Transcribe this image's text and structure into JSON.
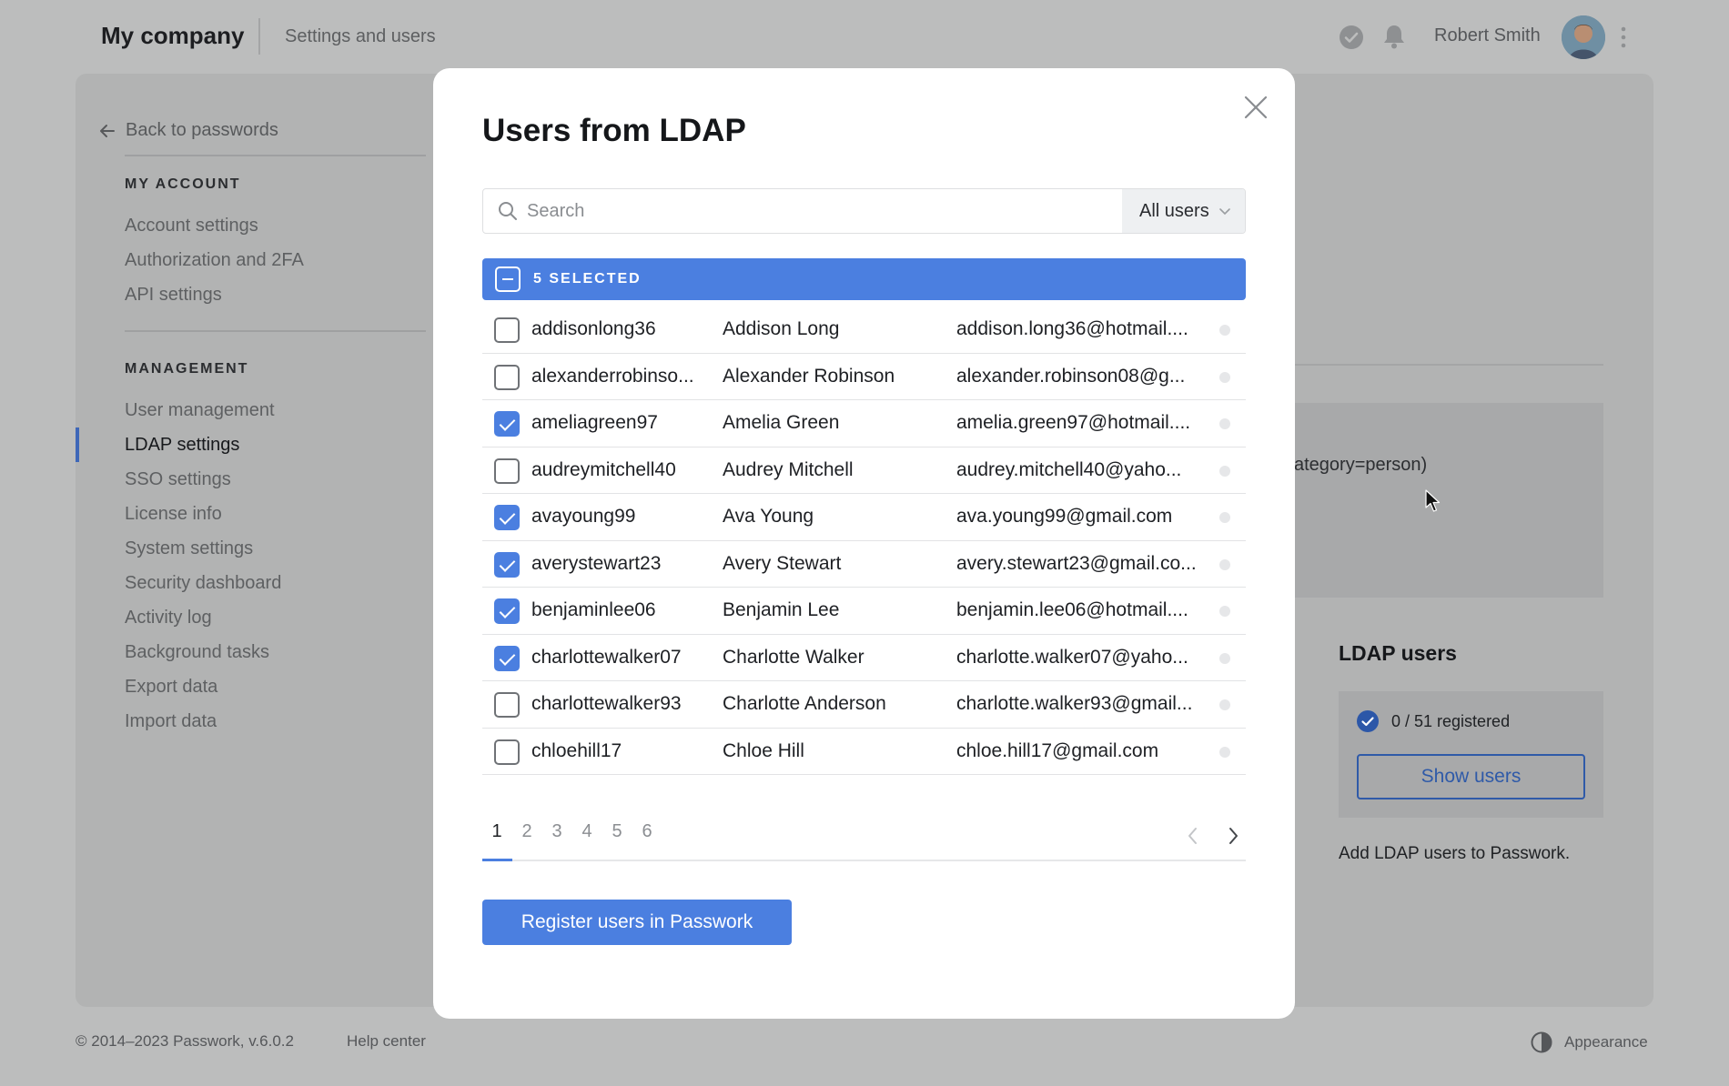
{
  "topbar": {
    "company": "My company",
    "section": "Settings and users",
    "user_name": "Robert Smith",
    "icons": [
      "check-circle-icon",
      "bell-icon",
      "avatar",
      "kebab-menu-icon"
    ]
  },
  "sidebar": {
    "back_label": "Back to passwords",
    "my_account_heading": "MY ACCOUNT",
    "my_account_items": [
      "Account settings",
      "Authorization and 2FA",
      "API settings"
    ],
    "management_heading": "MANAGEMENT",
    "management_items": [
      "User management",
      "LDAP settings",
      "SSO settings",
      "License info",
      "System settings",
      "Security dashboard",
      "Activity log",
      "Background tasks",
      "Export data",
      "Import data"
    ],
    "active_item": "LDAP settings"
  },
  "right_panel": {
    "filter_fragment": "ategory=person)",
    "ldap_users_title": "LDAP users",
    "registered_text": "0 / 51 registered",
    "show_users_label": "Show users",
    "add_ldap_text": "Add LDAP users to Passwork."
  },
  "footer": {
    "copyright": "© 2014–2023 Passwork, v.6.0.2",
    "help": "Help center",
    "appearance": "Appearance"
  },
  "modal": {
    "title": "Users from LDAP",
    "search_placeholder": "Search",
    "filter_value": "All users",
    "selected_label": "5 SELECTED",
    "users": [
      {
        "login": "addisonlong36",
        "name": "Addison Long",
        "email": "addison.long36@hotmail....",
        "checked": false
      },
      {
        "login": "alexanderrobinso...",
        "name": "Alexander Robinson",
        "email": "alexander.robinson08@g...",
        "checked": false
      },
      {
        "login": "ameliagreen97",
        "name": "Amelia Green",
        "email": "amelia.green97@hotmail....",
        "checked": true
      },
      {
        "login": "audreymitchell40",
        "name": "Audrey Mitchell",
        "email": "audrey.mitchell40@yaho...",
        "checked": false
      },
      {
        "login": "avayoung99",
        "name": "Ava Young",
        "email": "ava.young99@gmail.com",
        "checked": true
      },
      {
        "login": "averystewart23",
        "name": "Avery Stewart",
        "email": "avery.stewart23@gmail.co...",
        "checked": true
      },
      {
        "login": "benjaminlee06",
        "name": "Benjamin Lee",
        "email": "benjamin.lee06@hotmail....",
        "checked": true
      },
      {
        "login": "charlottewalker07",
        "name": "Charlotte Walker",
        "email": "charlotte.walker07@yaho...",
        "checked": true
      },
      {
        "login": "charlottewalker93",
        "name": "Charlotte Anderson",
        "email": "charlotte.walker93@gmail...",
        "checked": false
      },
      {
        "login": "chloehill17",
        "name": "Chloe Hill",
        "email": "chloe.hill17@gmail.com",
        "checked": false
      }
    ],
    "pages": [
      "1",
      "2",
      "3",
      "4",
      "5",
      "6"
    ],
    "current_page": "1",
    "register_label": "Register users in Passwork"
  },
  "colors": {
    "accent": "#4b7fe0",
    "overlay_bg": "#bcbdbd"
  }
}
